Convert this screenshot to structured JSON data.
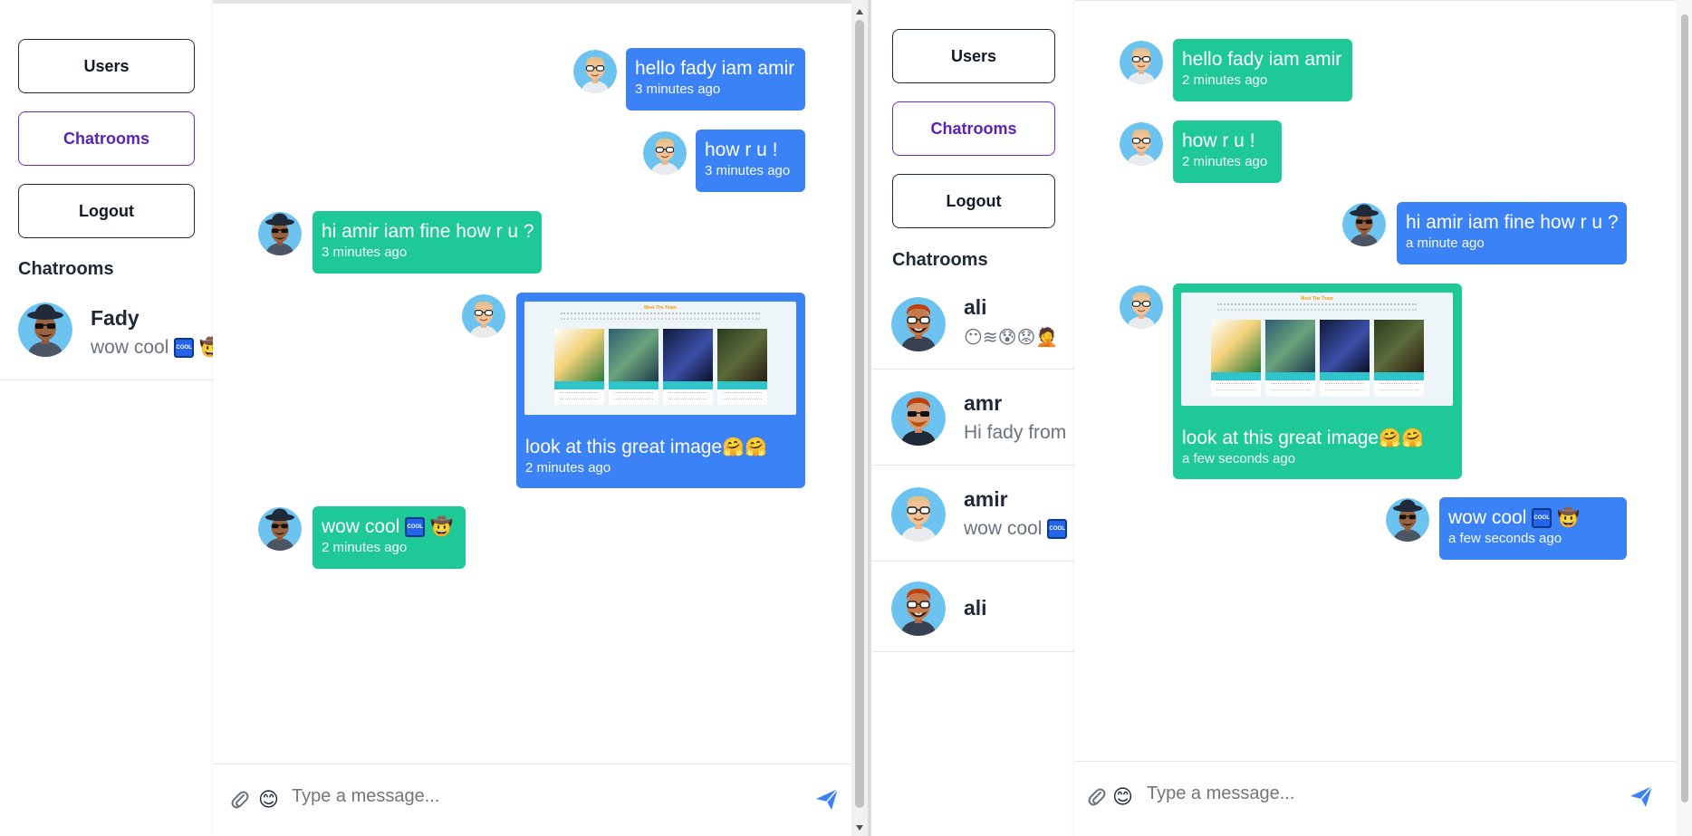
{
  "left_pane": {
    "nav": {
      "users": "Users",
      "chatrooms": "Chatrooms",
      "logout": "Logout"
    },
    "sidebar_title": "Chatrooms",
    "rooms": [
      {
        "name": "Fady",
        "last_message": "wow cool"
      }
    ],
    "messages": [
      {
        "text": "hello fady iam amir",
        "time": "3 minutes ago",
        "side": "right",
        "color": "blue"
      },
      {
        "text": "how r u !",
        "time": "3 minutes ago",
        "side": "right",
        "color": "blue"
      },
      {
        "text": "hi amir iam fine how r u ?",
        "time": "3 minutes ago",
        "side": "left",
        "color": "green"
      },
      {
        "text": "look at this great image",
        "time": "2 minutes ago",
        "side": "right",
        "color": "blue",
        "image_title": "Meet The Team"
      },
      {
        "text": "wow cool",
        "time": "2 minutes ago",
        "side": "left",
        "color": "green"
      }
    ],
    "composer": {
      "placeholder": "Type a message..."
    }
  },
  "right_pane": {
    "nav": {
      "users": "Users",
      "chatrooms": "Chatrooms",
      "logout": "Logout"
    },
    "sidebar_title": "Chatrooms",
    "rooms": [
      {
        "name": "ali",
        "last_message": ""
      },
      {
        "name": "amr",
        "last_message": "Hi fady from"
      },
      {
        "name": "amir",
        "last_message": "wow cool"
      },
      {
        "name": "ali",
        "last_message": ""
      }
    ],
    "messages": [
      {
        "text": "hello fady iam amir",
        "time": "2 minutes ago",
        "side": "left",
        "color": "green"
      },
      {
        "text": "how r u !",
        "time": "2 minutes ago",
        "side": "left",
        "color": "green"
      },
      {
        "text": "hi amir iam fine how r u ?",
        "time": "a minute ago",
        "side": "right",
        "color": "blue"
      },
      {
        "text": "look at this great image",
        "time": "a few seconds ago",
        "side": "left",
        "color": "green",
        "image_title": "Meet The Team"
      },
      {
        "text": "wow cool",
        "time": "a few seconds ago",
        "side": "right",
        "color": "blue"
      }
    ],
    "composer": {
      "placeholder": "Type a message..."
    }
  },
  "colors": {
    "blue_bubble": "#3b82f6",
    "green_bubble": "#1ec997",
    "active_nav": "#6d28d9",
    "send_icon": "#3b82f6"
  },
  "icons": {
    "attach": "paperclip-icon",
    "emoji": "smiley-icon",
    "send": "paper-plane-icon",
    "cool": "cool-button-emoji",
    "cowboy": "cowboy-emoji"
  }
}
